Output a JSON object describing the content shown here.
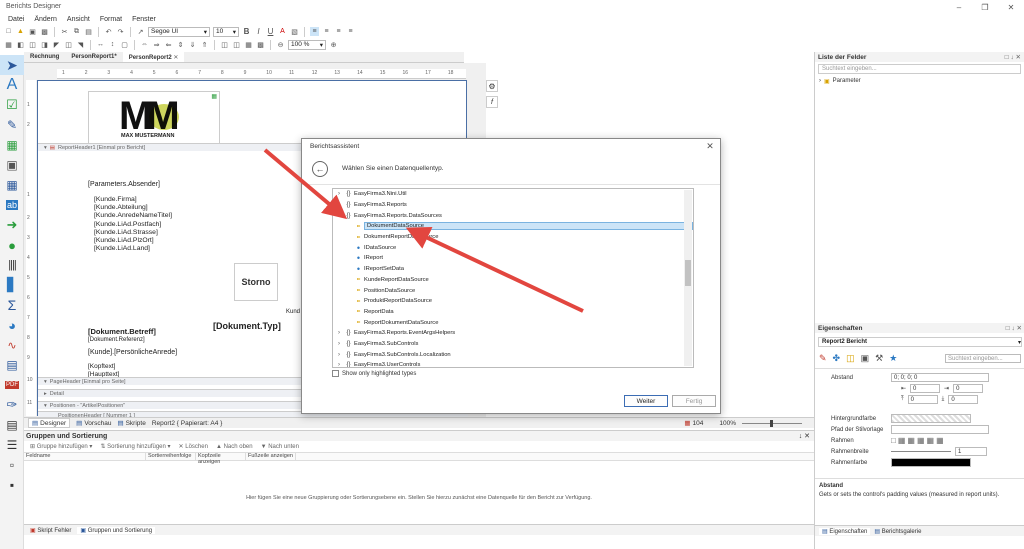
{
  "window": {
    "title": "Berichts Designer"
  },
  "menu": [
    "Datei",
    "Ändern",
    "Ansicht",
    "Format",
    "Fenster"
  ],
  "toolbar": {
    "font": "Segoe UI",
    "size": "10",
    "zoom": "100 %"
  },
  "doc_tabs": [
    "Rechnung",
    "PersonReport1*",
    "PersonReport2"
  ],
  "ruler_h": [
    "1",
    "2",
    "3",
    "4",
    "5",
    "6",
    "7",
    "8",
    "9",
    "10",
    "11",
    "12",
    "13",
    "14",
    "15",
    "16",
    "17",
    "18"
  ],
  "ruler_v": [
    "1",
    "2",
    "1",
    "2",
    "3",
    "4",
    "5",
    "6",
    "7",
    "8",
    "9",
    "10",
    "11"
  ],
  "logo": {
    "letters": "MM",
    "caption": "MAX MUSTERMANN"
  },
  "report": {
    "band_header": "ReportHeader1 [Einmal pro Bericht]",
    "absender": "[Parameters.Absender]",
    "address": [
      "[Kunde.Firma]",
      "[Kunde.Abteilung]",
      "[Kunde.AnredeNameTitel]",
      "[Kunde.LiAd.Postfach]",
      "[Kunde.LiAd.Strasse]",
      "[Kunde.LiAd.PlzOrt]",
      "[Kunde.LiAd.Land]"
    ],
    "storno": "Storno",
    "kunde_frag": "Kund",
    "betreff": "[Dokument.Betreff]",
    "referenz": "[Dokument.Referenz]",
    "anrede": "[Kunde].[PersönlicheAnrede]",
    "kopftext": "[Kopftext]",
    "haupttext": "[Haupttext]",
    "doktyp_frag": "[Dokument.Typ]",
    "band_page": "PageHeader [Einmal pro Seite]",
    "band_detail": "Detail",
    "band_pos": "Positionen - \"ArtikelPositionen\"",
    "band_pos_header": "PositionenHeader [ Nummer 1 ]"
  },
  "statusbar": {
    "designer": "Designer",
    "vorschau": "Vorschau",
    "skripte": "Skripte",
    "report": "Report2 { Papierart: A4 }",
    "count": "104",
    "zoom": "100%"
  },
  "grouping": {
    "title": "Gruppen und Sortierung",
    "tools": [
      "Gruppe hinzufügen",
      "Sortierung hinzufügen",
      "Löschen",
      "Nach oben",
      "Nach unten"
    ],
    "columns": [
      "Feldname",
      "Sortierreihenfolge",
      "Kopfzeile anzeigen",
      "Fußzeile anzeigen"
    ],
    "empty_msg": "Hier fügen Sie eine neue Gruppierung oder Sortierungsebene ein. Stellen Sie hierzu zunächst eine Datenquelle für den Bericht zur Verfügung."
  },
  "bottom_tabs": [
    "Skript Fehler",
    "Gruppen und Sortierung"
  ],
  "folders": {
    "title": "Liste der Felder",
    "search": "Suchtext eingeben...",
    "item": "Parameter"
  },
  "properties": {
    "title": "Eigenschaften",
    "object": "Report2  Bericht",
    "search": "Suchtext eingeben...",
    "abstand_label": "Abstand",
    "abstand_value": "0; 0; 0; 0",
    "zero": "0",
    "hintergrund": "Hintergrundfarbe",
    "pfad": "Pfad der Stilvorlage",
    "rahmen": "Rahmen",
    "rahmenbreite": "Rahmenbreite",
    "rahmenbreite_val": "1",
    "rahmenfarbe": "Rahmenfarbe",
    "desc_title": "Abstand",
    "desc_text": "Gets or sets the control's padding values (measured in report units).",
    "tabs": [
      "Eigenschaften",
      "Berichtsgalerie"
    ]
  },
  "dialog": {
    "title": "Berichtsassistent",
    "subtitle": "Wählen Sie einen Datenquellentyp.",
    "tree": [
      {
        "label": "EasyFirma3.Nini.Util",
        "kind": "ns",
        "indent": 0,
        "exp": ">"
      },
      {
        "label": "EasyFirma3.Reports",
        "kind": "ns",
        "indent": 0,
        "exp": ">"
      },
      {
        "label": "EasyFirma3.Reports.DataSources",
        "kind": "ns",
        "indent": 0,
        "exp": "v"
      },
      {
        "label": "DokumentDataSource",
        "kind": "class",
        "indent": 1,
        "exp": "",
        "selected": true
      },
      {
        "label": "DokumentReportDataSource",
        "kind": "class",
        "indent": 1,
        "exp": ""
      },
      {
        "label": "IDataSource",
        "kind": "iface",
        "indent": 1,
        "exp": ""
      },
      {
        "label": "IReport",
        "kind": "iface",
        "indent": 1,
        "exp": ""
      },
      {
        "label": "IReportSetData",
        "kind": "iface",
        "indent": 1,
        "exp": ""
      },
      {
        "label": "KundeReportDataSource",
        "kind": "class",
        "indent": 1,
        "exp": ""
      },
      {
        "label": "PositionDataSource",
        "kind": "class",
        "indent": 1,
        "exp": ""
      },
      {
        "label": "ProduktReportDataSource",
        "kind": "class",
        "indent": 1,
        "exp": ""
      },
      {
        "label": "ReportData",
        "kind": "class",
        "indent": 1,
        "exp": ""
      },
      {
        "label": "ReportDokumentDataSource",
        "kind": "class",
        "indent": 1,
        "exp": ""
      },
      {
        "label": "EasyFirma3.Reports.EventArgsHelpers",
        "kind": "ns",
        "indent": 0,
        "exp": ">"
      },
      {
        "label": "EasyFirma3.SubControls",
        "kind": "ns",
        "indent": 0,
        "exp": ">"
      },
      {
        "label": "EasyFirma3.SubControls.Localization",
        "kind": "ns",
        "indent": 0,
        "exp": ">"
      },
      {
        "label": "EasyFirma3.UserControls",
        "kind": "ns",
        "indent": 0,
        "exp": ">"
      }
    ],
    "checkbox": "Show only highlighted types",
    "next": "Weiter",
    "finish": "Fertig"
  },
  "colors": {
    "arrow": "#e2463f",
    "accent": "#3c6db4",
    "selection": "#cce4f7"
  }
}
